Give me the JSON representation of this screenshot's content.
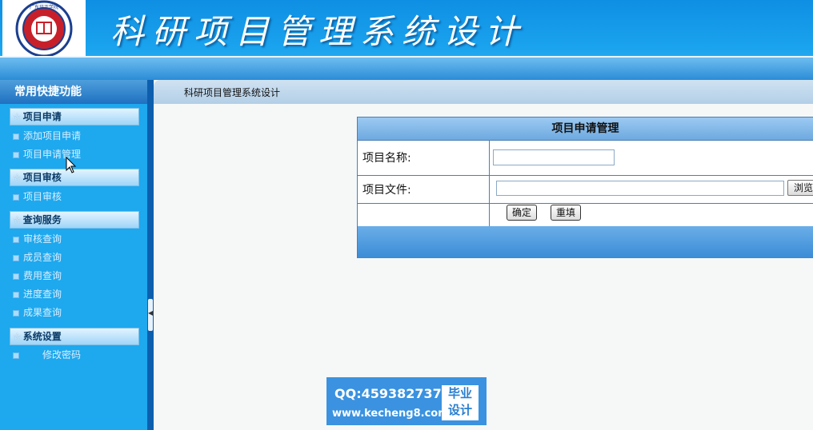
{
  "header": {
    "site_title": "科研项目管理系统设计",
    "logo_text": "广东培正学院 GUANGDONG PEI ZHENG COLLEGE"
  },
  "sidebar": {
    "title": "常用快捷功能",
    "sections": [
      {
        "label": "项目申请",
        "items": [
          "添加项目申请",
          "项目申请管理"
        ]
      },
      {
        "label": "项目审核",
        "items": [
          "项目审核"
        ]
      },
      {
        "label": "查询服务",
        "items": [
          "审核查询",
          "成员查询",
          "费用查询",
          "进度查询",
          "成果查询"
        ]
      },
      {
        "label": "系统设置",
        "items": [
          "修改密码"
        ]
      }
    ]
  },
  "breadcrumb": "科研项目管理系统设计",
  "form": {
    "title": "项目申请管理",
    "name_label": "项目名称:",
    "name_value": "",
    "file_label": "项目文件:",
    "file_value": "",
    "browse_label": "浏览",
    "confirm_label": "确定",
    "reset_label": "重填"
  },
  "watermark": {
    "qq": "QQ:459382737",
    "url": "www.kecheng8.com",
    "badge_line1": "毕业",
    "badge_line2": "设计"
  },
  "colors": {
    "header_blue": "#1aa3ee",
    "sidebar_blue": "#1ea8ee",
    "form_border": "#4a7fb3"
  }
}
